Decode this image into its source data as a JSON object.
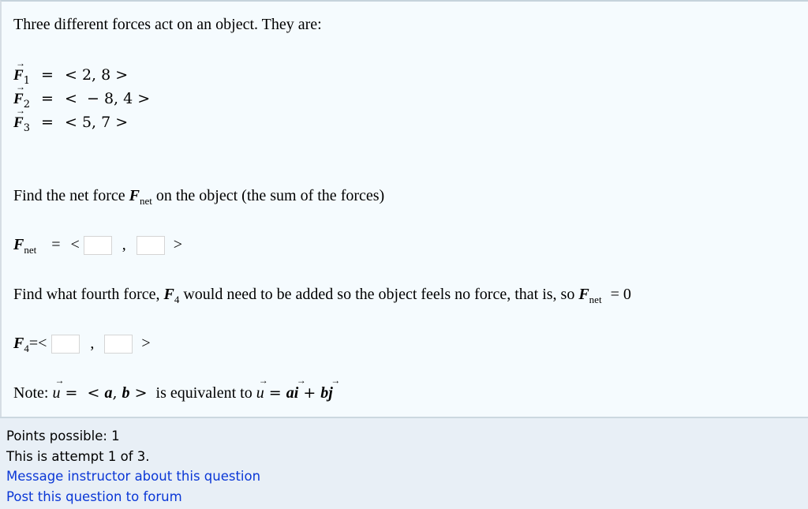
{
  "question": {
    "intro": "Three different forces act on an object. They are:",
    "forces": [
      {
        "symbol": "F",
        "sub": "1",
        "components": "< 2, 8 >"
      },
      {
        "symbol": "F",
        "sub": "2",
        "components": "<  − 8, 4 >"
      },
      {
        "symbol": "F",
        "sub": "3",
        "components": "< 5, 7 >"
      }
    ],
    "part1": {
      "prompt_before": "Find the net force ",
      "symbol": "F",
      "symbol_sub": "net",
      "prompt_after": " on the object (the sum of the forces)",
      "answer_label_symbol": "F",
      "answer_label_sub": "net",
      "equals": "=",
      "open": "<",
      "comma": ",",
      "close": ">",
      "inputs": [
        "",
        ""
      ]
    },
    "part2": {
      "prompt_before": "Find what fourth force, ",
      "symbol": "F",
      "symbol_sub": "4",
      "prompt_mid": " would need to be added so the object feels no force, that is, so ",
      "net_symbol": "F",
      "net_sub": "net",
      "prompt_end": " = 0",
      "answer_label_symbol": "F",
      "answer_label_sub": "4",
      "equals": "=",
      "open": "<",
      "comma": ",",
      "close": ">",
      "inputs": [
        "",
        ""
      ]
    },
    "note": {
      "label": "Note: ",
      "u": "u",
      "eq1": " =  < ",
      "a": "a",
      "comma": ", ",
      "b": "b",
      "close": " > ",
      "middle": " is equivalent to ",
      "eq2": " = ",
      "i": "i",
      "plus": " + ",
      "j": "j"
    }
  },
  "footer": {
    "points": "Points possible: 1",
    "attempt": "This is attempt 1 of 3.",
    "message_link": "Message instructor about this question",
    "forum_link": "Post this question to forum"
  }
}
